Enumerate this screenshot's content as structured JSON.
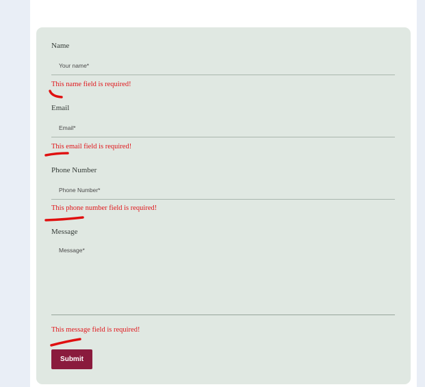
{
  "colors": {
    "page_background": "#e9eef6",
    "form_background": "#e0e8e2",
    "error_text": "#e0161b",
    "submit_background": "#8a1b3d",
    "annotation_stroke": "#e01010"
  },
  "form": {
    "name": {
      "label": "Name",
      "placeholder": "Your name*",
      "value": "",
      "error": "This name field is required!"
    },
    "email": {
      "label": "Email",
      "placeholder": "Email*",
      "value": "",
      "error": "This email field is required!"
    },
    "phone": {
      "label": "Phone Number",
      "placeholder": "Phone Number*",
      "value": "",
      "error": "This phone number field is required!"
    },
    "message": {
      "label": "Message",
      "placeholder": "Message*",
      "value": "",
      "error": "This message field is required!"
    },
    "submit_label": "Submit"
  }
}
